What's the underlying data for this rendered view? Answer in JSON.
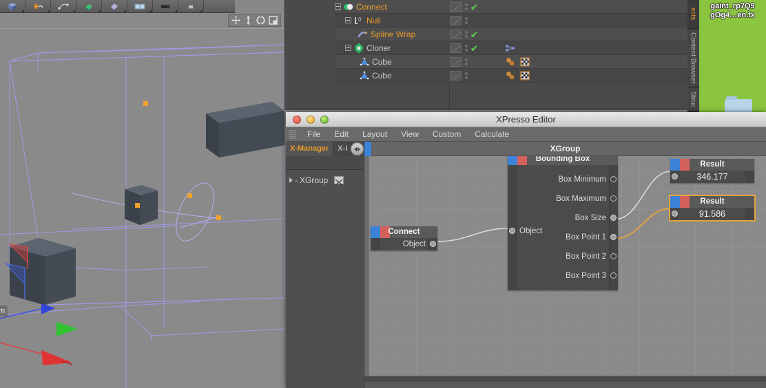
{
  "toolbar": {
    "buttons": [
      {
        "name": "primitive-tool",
        "icon": "cube-icon"
      },
      {
        "name": "add-spline-tool",
        "icon": "plus-spline-icon"
      },
      {
        "name": "nurbs-tool",
        "icon": "nurbs-icon"
      },
      {
        "name": "modeling-tool",
        "icon": "green-poly-icon"
      },
      {
        "name": "deformer-tool",
        "icon": "deformer-icon"
      },
      {
        "name": "scene-tool",
        "icon": "scene-icon"
      },
      {
        "name": "camera-tool",
        "icon": "camera-icon"
      },
      {
        "name": "light-tool",
        "icon": "light-icon"
      }
    ]
  },
  "viewport": {
    "label": "m",
    "nav_icons": [
      "move-icon",
      "zoom-icon",
      "rotate-icon",
      "maximize-icon"
    ]
  },
  "object_manager": {
    "rows": [
      {
        "label": "Connect",
        "icon": "connect-icon",
        "indent": 0,
        "highlight": true,
        "check": true,
        "expander": true,
        "tags": []
      },
      {
        "label": "Null",
        "icon": "null-icon",
        "indent": 1,
        "highlight": true,
        "check": false,
        "expander": true,
        "tags": []
      },
      {
        "label": "Spline Wrap",
        "icon": "spline-wrap-icon",
        "indent": 2,
        "highlight": true,
        "check": true,
        "expander": false,
        "tags": []
      },
      {
        "label": "Cloner",
        "icon": "cloner-icon",
        "indent": 1,
        "highlight": false,
        "check": true,
        "expander": true,
        "tags": [
          "mograph-tag"
        ]
      },
      {
        "label": "Cube",
        "icon": "cube-blue-icon",
        "indent": 2,
        "highlight": false,
        "check": false,
        "expander": false,
        "tags": [
          "material-tag",
          "texture-tag"
        ]
      },
      {
        "label": "Cube",
        "icon": "cube-blue-icon",
        "indent": 2,
        "highlight": false,
        "check": false,
        "expander": false,
        "tags": [
          "material-tag",
          "texture-tag"
        ]
      }
    ]
  },
  "right_panel": {
    "tabs": [
      {
        "label": "ects",
        "active": true
      },
      {
        "label": "Content Browser",
        "active": false
      },
      {
        "label": "Struc",
        "active": false
      }
    ],
    "desktop_filename": "gaint_rp7Q9\ngOg4…en.tx"
  },
  "xpresso": {
    "window_title": "XPresso Editor",
    "window_buttons": [
      "close-button",
      "minimize-button",
      "zoom-button"
    ],
    "menus": [
      "File",
      "Edit",
      "Layout",
      "View",
      "Custom",
      "Calculate"
    ],
    "sidebar": {
      "tabs": [
        {
          "label": "X-Manager",
          "active": true
        },
        {
          "label": "X-I",
          "active": false
        }
      ],
      "search_placeholder": "",
      "search_value": "",
      "tree": [
        {
          "label": "XGroup"
        }
      ]
    },
    "graph": {
      "group_title": "XGroup",
      "nodes": [
        {
          "id": "connect",
          "title": "Connect",
          "selected": false,
          "outputs": [
            {
              "label": "Object",
              "connected": true
            }
          ],
          "inputs": []
        },
        {
          "id": "bounding-box",
          "title": "Bounding Box",
          "selected": false,
          "inputs": [
            {
              "label": "Object",
              "connected": true
            }
          ],
          "outputs": [
            {
              "label": "Box Minimum",
              "connected": false
            },
            {
              "label": "Box Maximum",
              "connected": false
            },
            {
              "label": "Box Size",
              "connected": true
            },
            {
              "label": "Box Point 1",
              "connected": true
            },
            {
              "label": "Box Point 2",
              "connected": false
            },
            {
              "label": "Box Point 3",
              "connected": false
            }
          ]
        },
        {
          "id": "result-1",
          "title": "Result",
          "value": "346.177",
          "selected": false,
          "inputs": [
            {
              "label": "",
              "connected": true
            }
          ]
        },
        {
          "id": "result-2",
          "title": "Result",
          "value": "91.586",
          "selected": true,
          "inputs": [
            {
              "label": "",
              "connected": true
            }
          ]
        }
      ],
      "wires": [
        {
          "from": "connect.Object",
          "to": "bounding-box.Object",
          "color": "#d9d9d9"
        },
        {
          "from": "bounding-box.Box Size",
          "to": "result-1.in",
          "color": "#d9d9d9"
        },
        {
          "from": "bounding-box.Box Point 1",
          "to": "result-2.in",
          "color": "#e8a33d"
        }
      ]
    }
  },
  "colors": {
    "accent_orange": "#e89a2c",
    "port_blue": "#3b82d8",
    "port_red": "#d4625c",
    "check_green": "#55c24a",
    "wire_default": "#d9d9d9",
    "wire_selected": "#e8a33d",
    "wireframe_purple": "#9f9ae8"
  }
}
